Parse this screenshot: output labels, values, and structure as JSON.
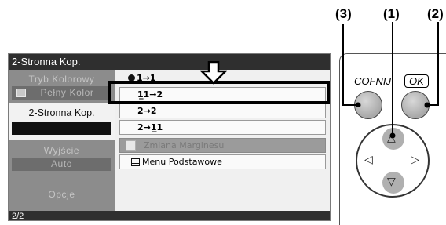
{
  "callouts": [
    "(3)",
    "(1)",
    "(2)"
  ],
  "screen": {
    "title": "2-Stronna Kop.",
    "page_indicator": "2/2",
    "left_menu": {
      "color_mode_label": "Tryb Kolorowy",
      "color_mode_value": "Pełny Kolor",
      "duplex_label": "2-Stronna Kop.",
      "duplex_value": "",
      "output_label": "Wyjście",
      "output_value": "Auto",
      "options_label": "Opcje"
    },
    "options": [
      {
        "label": "1→1",
        "state": "radio-selected"
      },
      {
        "label": "1̲1→2",
        "state": "highlighted"
      },
      {
        "label": "2→2",
        "state": "normal"
      },
      {
        "label": "2→1̲1",
        "state": "normal"
      },
      {
        "label": "Zmiana Marginesu",
        "state": "disabled"
      },
      {
        "label": "Menu Podstawowe",
        "state": "menu"
      }
    ]
  },
  "buttons": {
    "back_label": "COFNIJ",
    "ok_label": "OK"
  },
  "dpad": {
    "up": "△",
    "down": "▽",
    "left": "◁",
    "right": "▷"
  }
}
